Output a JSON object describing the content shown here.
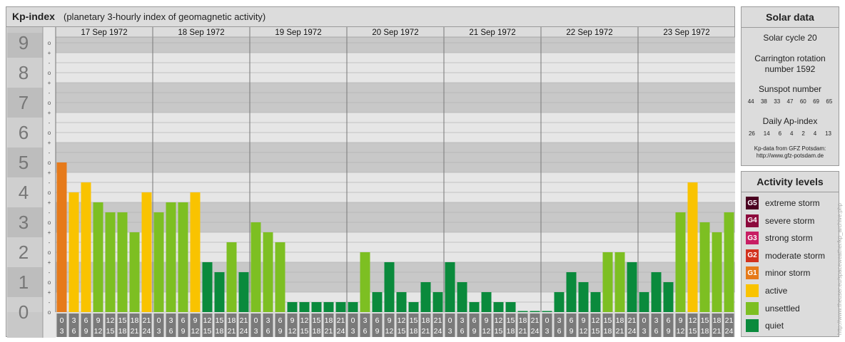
{
  "header": {
    "title": "Kp-index",
    "subtitle": "(planetary 3-hourly index of geomagnetic activity)"
  },
  "chart_data": {
    "type": "bar",
    "days": [
      "17 Sep 1972",
      "18 Sep 1972",
      "19 Sep 1972",
      "20 Sep 1972",
      "21 Sep 1972",
      "22 Sep 1972",
      "23 Sep 1972"
    ],
    "hour_start_labels": [
      "0",
      "3",
      "6",
      "9",
      "12",
      "15",
      "18",
      "21"
    ],
    "hour_end_labels": [
      "3",
      "6",
      "9",
      "12",
      "15",
      "18",
      "21",
      "24"
    ],
    "y_tick_labels": [
      "0",
      "1",
      "2",
      "3",
      "4",
      "5",
      "6",
      "7",
      "8",
      "9"
    ],
    "y_minor_labels": [
      "+",
      "-",
      "o"
    ],
    "ylim": [
      0,
      9.33
    ],
    "values": [
      5.0,
      4.0,
      4.333,
      3.667,
      3.333,
      3.333,
      2.667,
      4.0,
      3.333,
      3.667,
      3.667,
      4.0,
      1.667,
      1.333,
      2.333,
      1.333,
      3.0,
      2.667,
      2.333,
      0.333,
      0.333,
      0.333,
      0.333,
      0.333,
      0.333,
      2.0,
      0.667,
      1.667,
      0.667,
      0.333,
      1.0,
      0.667,
      1.667,
      1.0,
      0.333,
      0.667,
      0.333,
      0.333,
      0.0,
      0.0,
      0.0,
      0.667,
      1.333,
      1.0,
      0.667,
      2.0,
      2.0,
      1.667,
      0.667,
      1.333,
      1.0,
      3.333,
      4.333,
      3.0,
      2.667,
      3.333
    ],
    "level_colors": {
      "quiet": "#0a8a3c",
      "unsettled": "#7dbf22",
      "active": "#f9c300",
      "minor": "#e67a1a"
    }
  },
  "solar": {
    "heading": "Solar data",
    "cycle": "Solar cycle 20",
    "carrington_line1": "Carrington rotation",
    "carrington_line2": "number 1592",
    "sunspot_label": "Sunspot number",
    "sunspot_values": [
      "44",
      "38",
      "33",
      "47",
      "60",
      "69",
      "65"
    ],
    "ap_label": "Daily Ap-index",
    "ap_values": [
      "26",
      "14",
      "6",
      "4",
      "2",
      "4",
      "13"
    ],
    "credit_line1": "Kp-data from GFZ Potsdam:",
    "credit_line2": "http://www.gfz-potsdam.de"
  },
  "activity": {
    "heading": "Activity levels",
    "items": [
      {
        "code": "G5",
        "label": "extreme storm",
        "color": "#4a0020"
      },
      {
        "code": "G4",
        "label": "severe storm",
        "color": "#8c0a3c"
      },
      {
        "code": "G3",
        "label": "strong storm",
        "color": "#c81e64"
      },
      {
        "code": "G2",
        "label": "moderate storm",
        "color": "#d2321e"
      },
      {
        "code": "G1",
        "label": "minor storm",
        "color": "#e67a1a"
      },
      {
        "code": "",
        "label": "active",
        "color": "#f9c300"
      },
      {
        "code": "",
        "label": "unsettled",
        "color": "#7dbf22"
      },
      {
        "code": "",
        "label": "quiet",
        "color": "#0a8a3c"
      }
    ]
  },
  "watermark": "http://www.theuser.eu/spaceweather/kp_archive.php"
}
